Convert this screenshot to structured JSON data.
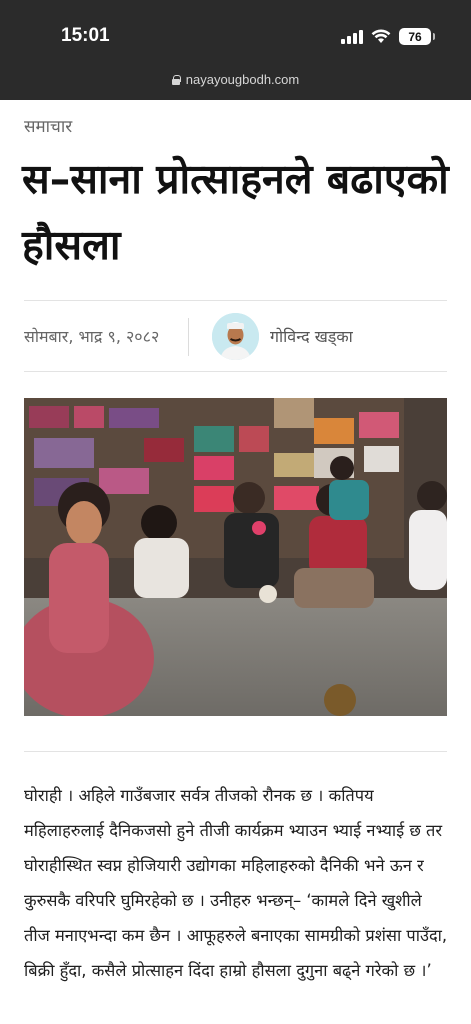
{
  "status_bar": {
    "time": "15:01",
    "battery": "76",
    "icons": [
      "signal-icon",
      "wifi-icon",
      "battery-icon"
    ]
  },
  "browser": {
    "url": "nayayougbodh.com",
    "icons": [
      "lock-icon"
    ]
  },
  "article": {
    "category": "समाचार",
    "title": "स–साना प्रोत्साहनले बढाएको हौसला",
    "date": "सोमबार, भाद्र ९, २०८२",
    "author": "गोविन्द खड्का",
    "body": "घोराही । अहिले गाउँबजार सर्वत्र तीजको रौनक छ । कतिपय महिलाहरुलाई दैनिकजसो हुने तीजी कार्यक्रम भ्याउन भ्याई नभ्याई छ तर घोराहीस्थित स्वप्न होजियारी उद्योगका महिलाहरुको दैनिकी भने ऊन र कुरुसकै वरिपरि घुमिरहेको छ । उनीहरु भन्छन्– ‘कामले दिने खुशीले तीज मनाएभन्दा कम छैन । आफूहरुले बनाएका सामग्रीको प्रशंसा पाउँदा, बिक्री हुँदा, कसैले प्रोत्साहन दिंदा हाम्रो हौसला दुगुना बढ्ने गरेको छ ।’"
  },
  "colors": {
    "topbar": "#2b2b2b",
    "text": "#1a1a1a",
    "muted": "#666666",
    "avatar_bg": "#c9e9f0"
  }
}
